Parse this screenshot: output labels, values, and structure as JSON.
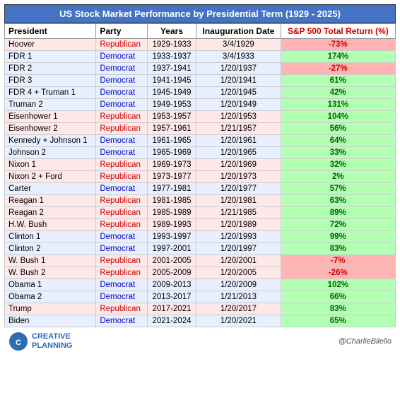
{
  "title": "US Stock Market Performance by Presidential Term (1929 - 2025)",
  "columns": [
    "President",
    "Party",
    "Years",
    "Inauguration Date",
    "S&P 500 Total Return (%)"
  ],
  "rows": [
    {
      "president": "Hoover",
      "party": "Republican",
      "party_type": "rep",
      "years": "1929-1933",
      "inaug": "3/4/1929",
      "ret": "-73%",
      "ret_type": "negative"
    },
    {
      "president": "FDR 1",
      "party": "Democrat",
      "party_type": "dem",
      "years": "1933-1937",
      "inaug": "3/4/1933",
      "ret": "174%",
      "ret_type": "positive"
    },
    {
      "president": "FDR 2",
      "party": "Democrat",
      "party_type": "dem",
      "years": "1937-1941",
      "inaug": "1/20/1937",
      "ret": "-27%",
      "ret_type": "negative"
    },
    {
      "president": "FDR 3",
      "party": "Democrat",
      "party_type": "dem",
      "years": "1941-1945",
      "inaug": "1/20/1941",
      "ret": "61%",
      "ret_type": "positive"
    },
    {
      "president": "FDR 4 + Truman 1",
      "party": "Democrat",
      "party_type": "dem",
      "years": "1945-1949",
      "inaug": "1/20/1945",
      "ret": "42%",
      "ret_type": "positive"
    },
    {
      "president": "Truman 2",
      "party": "Democrat",
      "party_type": "dem",
      "years": "1949-1953",
      "inaug": "1/20/1949",
      "ret": "131%",
      "ret_type": "positive"
    },
    {
      "president": "Eisenhower 1",
      "party": "Republican",
      "party_type": "rep",
      "years": "1953-1957",
      "inaug": "1/20/1953",
      "ret": "104%",
      "ret_type": "positive"
    },
    {
      "president": "Eisenhower 2",
      "party": "Republican",
      "party_type": "rep",
      "years": "1957-1961",
      "inaug": "1/21/1957",
      "ret": "56%",
      "ret_type": "positive"
    },
    {
      "president": "Kennedy + Johnson 1",
      "party": "Democrat",
      "party_type": "dem",
      "years": "1961-1965",
      "inaug": "1/20/1961",
      "ret": "64%",
      "ret_type": "positive"
    },
    {
      "president": "Johnson 2",
      "party": "Democrat",
      "party_type": "dem",
      "years": "1965-1969",
      "inaug": "1/20/1965",
      "ret": "33%",
      "ret_type": "positive"
    },
    {
      "president": "Nixon 1",
      "party": "Republican",
      "party_type": "rep",
      "years": "1969-1973",
      "inaug": "1/20/1969",
      "ret": "32%",
      "ret_type": "positive"
    },
    {
      "president": "Nixon 2 + Ford",
      "party": "Republican",
      "party_type": "rep",
      "years": "1973-1977",
      "inaug": "1/20/1973",
      "ret": "2%",
      "ret_type": "positive"
    },
    {
      "president": "Carter",
      "party": "Democrat",
      "party_type": "dem",
      "years": "1977-1981",
      "inaug": "1/20/1977",
      "ret": "57%",
      "ret_type": "positive"
    },
    {
      "president": "Reagan 1",
      "party": "Republican",
      "party_type": "rep",
      "years": "1981-1985",
      "inaug": "1/20/1981",
      "ret": "63%",
      "ret_type": "positive"
    },
    {
      "president": "Reagan 2",
      "party": "Republican",
      "party_type": "rep",
      "years": "1985-1989",
      "inaug": "1/21/1985",
      "ret": "89%",
      "ret_type": "positive"
    },
    {
      "president": "H.W. Bush",
      "party": "Republican",
      "party_type": "rep",
      "years": "1989-1993",
      "inaug": "1/20/1989",
      "ret": "72%",
      "ret_type": "positive"
    },
    {
      "president": "Clinton 1",
      "party": "Democrat",
      "party_type": "dem",
      "years": "1993-1997",
      "inaug": "1/20/1993",
      "ret": "99%",
      "ret_type": "positive"
    },
    {
      "president": "Clinton 2",
      "party": "Democrat",
      "party_type": "dem",
      "years": "1997-2001",
      "inaug": "1/20/1997",
      "ret": "83%",
      "ret_type": "positive"
    },
    {
      "president": "W. Bush 1",
      "party": "Republican",
      "party_type": "rep",
      "years": "2001-2005",
      "inaug": "1/20/2001",
      "ret": "-7%",
      "ret_type": "negative"
    },
    {
      "president": "W. Bush 2",
      "party": "Republican",
      "party_type": "rep",
      "years": "2005-2009",
      "inaug": "1/20/2005",
      "ret": "-26%",
      "ret_type": "negative"
    },
    {
      "president": "Obama 1",
      "party": "Democrat",
      "party_type": "dem",
      "years": "2009-2013",
      "inaug": "1/20/2009",
      "ret": "102%",
      "ret_type": "positive"
    },
    {
      "president": "Obama 2",
      "party": "Democrat",
      "party_type": "dem",
      "years": "2013-2017",
      "inaug": "1/21/2013",
      "ret": "66%",
      "ret_type": "positive"
    },
    {
      "president": "Trump",
      "party": "Republican",
      "party_type": "rep",
      "years": "2017-2021",
      "inaug": "1/20/2017",
      "ret": "83%",
      "ret_type": "positive"
    },
    {
      "president": "Biden",
      "party": "Democrat",
      "party_type": "dem",
      "years": "2021-2024",
      "inaug": "1/20/2021",
      "ret": "65%",
      "ret_type": "positive"
    }
  ],
  "footer": {
    "logo_line1": "CREATIVE",
    "logo_line2": "PLANNING",
    "credit": "@CharlieBilello"
  }
}
